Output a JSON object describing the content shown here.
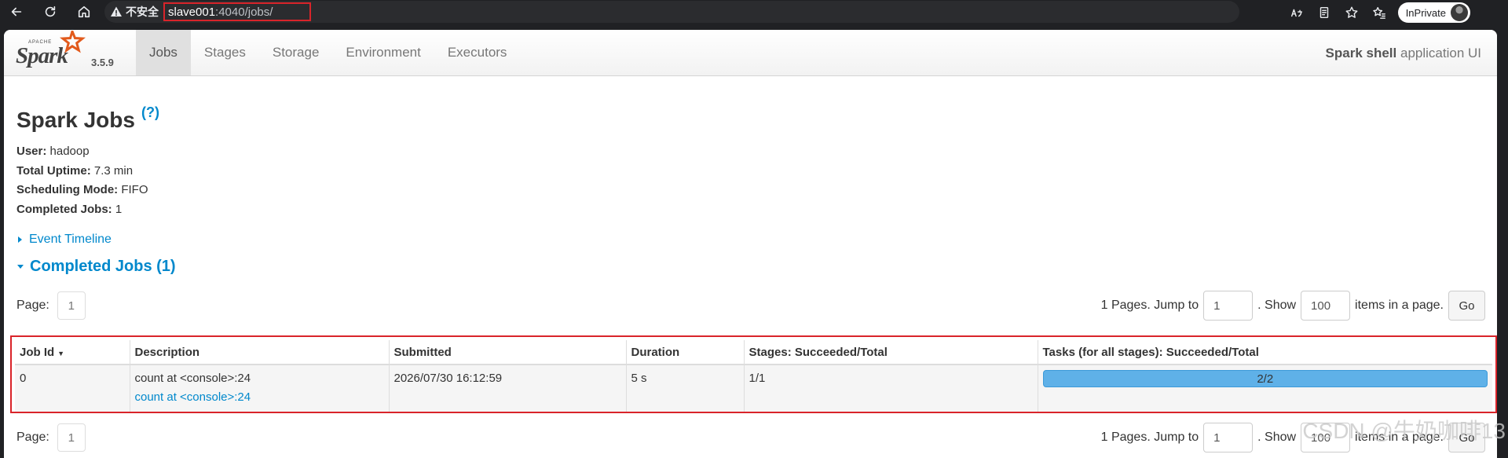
{
  "browser": {
    "insecure_label": "不安全",
    "url_host": "slave001",
    "url_path": ":4040/jobs/",
    "inprivate_label": "InPrivate"
  },
  "navbar": {
    "apache_text": "APACHE",
    "spark_text": "Spark",
    "version": "3.5.9",
    "tabs": [
      {
        "label": "Jobs",
        "active": true
      },
      {
        "label": "Stages"
      },
      {
        "label": "Storage"
      },
      {
        "label": "Environment"
      },
      {
        "label": "Executors"
      }
    ],
    "app_name": "Spark shell",
    "app_suffix": " application UI"
  },
  "heading": {
    "title": "Spark Jobs",
    "help": "(?)"
  },
  "summary": {
    "user_label": "User:",
    "user_value": " hadoop",
    "uptime_label": "Total Uptime:",
    "uptime_value": " 7.3 min",
    "mode_label": "Scheduling Mode:",
    "mode_value": " FIFO",
    "completed_label": "Completed Jobs:",
    "completed_value": " 1"
  },
  "timeline_label": "Event Timeline",
  "section_title": "Completed Jobs (1)",
  "pager_top": {
    "page_label": "Page:",
    "page_number": "1",
    "pages_text": "1 Pages. Jump to",
    "jump_value": "1",
    "show_text": ". Show",
    "show_value": "100",
    "items_text": "items in a page.",
    "go_label": "Go"
  },
  "pager_bottom": {
    "page_label": "Page:",
    "page_number": "1",
    "pages_text": "1 Pages. Jump to",
    "jump_value": "1",
    "show_text": ". Show",
    "show_value": "100",
    "items_text": "items in a page.",
    "go_label": "Go"
  },
  "table": {
    "headers": [
      "Job Id",
      "Description",
      "Submitted",
      "Duration",
      "Stages: Succeeded/Total",
      "Tasks (for all stages): Succeeded/Total"
    ],
    "rows": [
      {
        "job_id": "0",
        "description": "count at <console>:24",
        "description_link": "count at <console>:24",
        "submitted": "2026/07/30 16:12:59",
        "duration": "5 s",
        "stages": "1/1",
        "tasks": "2/2",
        "tasks_fraction": 1.0
      }
    ]
  },
  "watermark": "CSDN @牛奶咖啡13",
  "colors": {
    "link": "#0088cc",
    "highlight": "#d9242a",
    "progress": "#4aa3df"
  }
}
